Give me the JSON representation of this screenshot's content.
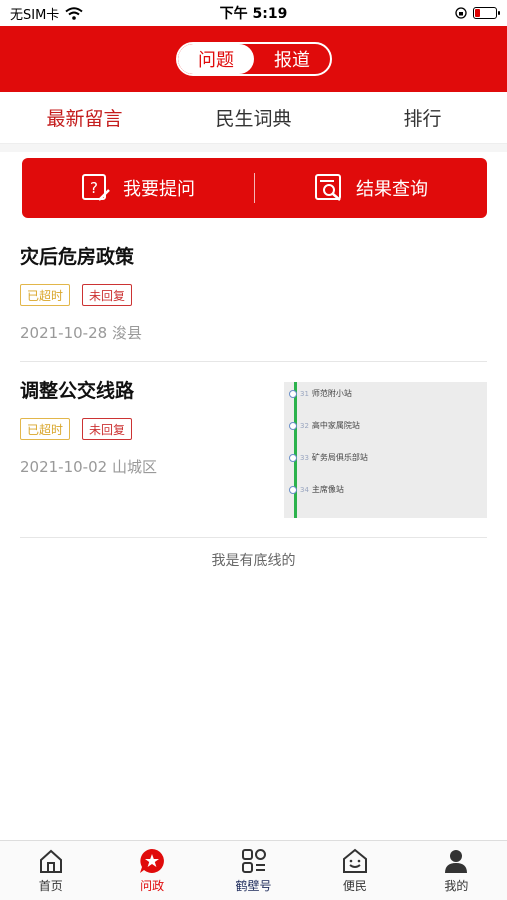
{
  "status": {
    "carrier": "无SIM卡",
    "time": "下午 5:19"
  },
  "header": {
    "segments": [
      "问题",
      "报道"
    ],
    "active_segment": 0
  },
  "subtabs": [
    "最新留言",
    "民生词典",
    "排行"
  ],
  "actions": {
    "ask": "我要提问",
    "query": "结果查询"
  },
  "items": [
    {
      "title": "灾后危房政策",
      "tags": [
        "已超时",
        "未回复"
      ],
      "date": "2021-10-28",
      "place": "浚县",
      "meta": "2021-10-28 浚县"
    },
    {
      "title": "调整公交线路",
      "tags": [
        "已超时",
        "未回复"
      ],
      "date": "2021-10-02",
      "place": "山城区",
      "meta": "2021-10-02 山城区",
      "thumbnail_stops": [
        {
          "num": "31",
          "name": "师范附小站"
        },
        {
          "num": "32",
          "name": "高中家属院站"
        },
        {
          "num": "33",
          "name": "矿务局俱乐部站"
        },
        {
          "num": "34",
          "name": "主席像站"
        }
      ]
    }
  ],
  "footer_note": "我是有底线的",
  "tabbar": [
    {
      "label": "首页",
      "icon": "home-icon"
    },
    {
      "label": "问政",
      "icon": "star-chat-icon"
    },
    {
      "label": "鹤壁号",
      "icon": "grid-icon"
    },
    {
      "label": "便民",
      "icon": "face-house-icon"
    },
    {
      "label": "我的",
      "icon": "person-icon"
    }
  ],
  "colors": {
    "brand": "#e00b0b",
    "overtime": "#d9a62a",
    "noreply": "#cc3333"
  }
}
